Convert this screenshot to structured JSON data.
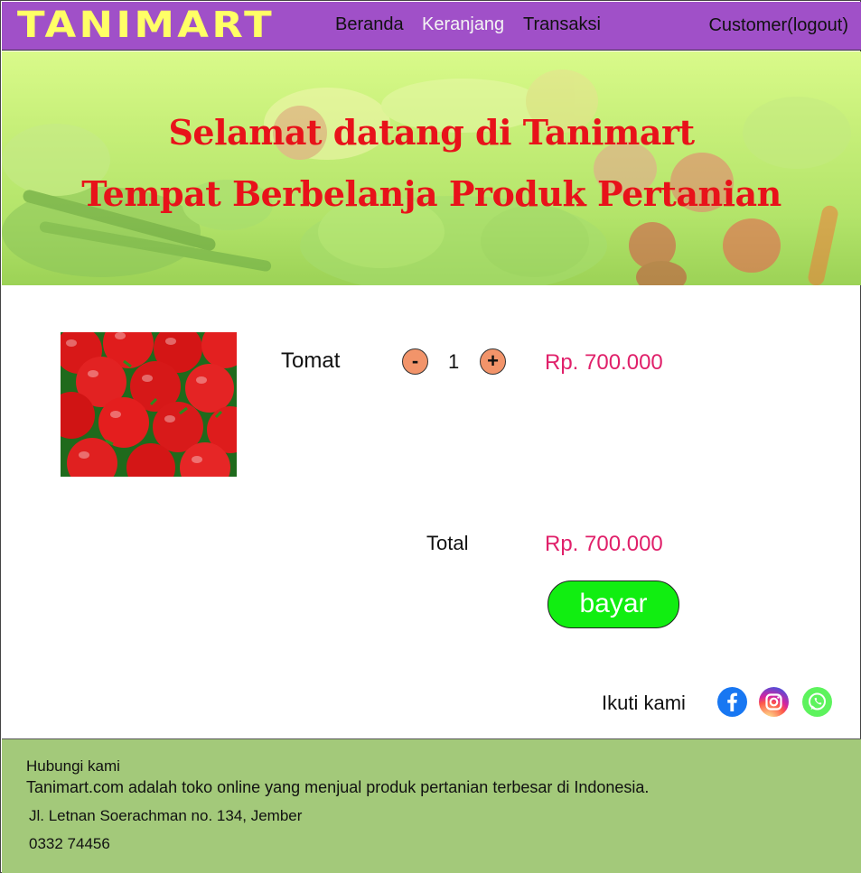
{
  "header": {
    "logo": "TANIMART",
    "nav": [
      "Beranda",
      "Keranjang",
      "Transaksi"
    ],
    "user": "Customer(logout)",
    "background": "#a050c8",
    "logo_color": "#ffff66"
  },
  "banner": {
    "line1": "Selamat datang di Tanimart",
    "line2": "Tempat Berbelanja Produk Pertanian",
    "text_color": "#e8121a"
  },
  "cart": {
    "item": {
      "name": "Tomat",
      "minus": "-",
      "quantity": "1",
      "plus": "+",
      "price": "Rp. 700.000",
      "image": "tomatoes-image"
    },
    "total_label": "Total",
    "total_value": "Rp. 700.000",
    "pay_button": "bayar",
    "price_color": "#e0206a",
    "pay_button_color": "#11ee11"
  },
  "social": {
    "label": "Ikuti kami",
    "icons": [
      "facebook-icon",
      "instagram-icon",
      "whatsapp-icon"
    ]
  },
  "footer": {
    "title": "Hubungi kami",
    "description": "Tanimart.com adalah toko online yang menjual produk pertanian terbesar di Indonesia.",
    "address": "Jl. Letnan Soerachman no. 134, Jember",
    "phone": "0332 74456",
    "background": "#a3c97a"
  }
}
